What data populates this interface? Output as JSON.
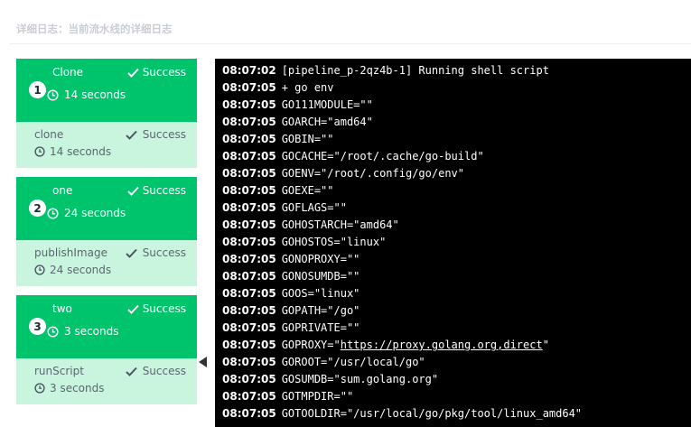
{
  "header": {
    "title": "详细日志：当前流水线的详细日志"
  },
  "stages": [
    {
      "num": "1",
      "name": "Clone",
      "status": "Success",
      "duration": "14 seconds",
      "step": {
        "name": "clone",
        "status": "Success",
        "duration": "14 seconds"
      }
    },
    {
      "num": "2",
      "name": "one",
      "status": "Success",
      "duration": "24 seconds",
      "step": {
        "name": "publishImage",
        "status": "Success",
        "duration": "24 seconds"
      }
    },
    {
      "num": "3",
      "name": "two",
      "status": "Success",
      "duration": "3 seconds",
      "step": {
        "name": "runScript",
        "status": "Success",
        "duration": "3 seconds"
      }
    }
  ],
  "log": {
    "lines": [
      {
        "time": "08:07:02",
        "text": "[pipeline_p-2qz4b-1] Running shell script"
      },
      {
        "time": "08:07:05",
        "text": "+ go env"
      },
      {
        "time": "08:07:05",
        "text": "GO111MODULE=\"\""
      },
      {
        "time": "08:07:05",
        "text": "GOARCH=\"amd64\""
      },
      {
        "time": "08:07:05",
        "text": "GOBIN=\"\""
      },
      {
        "time": "08:07:05",
        "text": "GOCACHE=\"/root/.cache/go-build\""
      },
      {
        "time": "08:07:05",
        "text": "GOENV=\"/root/.config/go/env\""
      },
      {
        "time": "08:07:05",
        "text": "GOEXE=\"\""
      },
      {
        "time": "08:07:05",
        "text": "GOFLAGS=\"\""
      },
      {
        "time": "08:07:05",
        "text": "GOHOSTARCH=\"amd64\""
      },
      {
        "time": "08:07:05",
        "text": "GOHOSTOS=\"linux\""
      },
      {
        "time": "08:07:05",
        "text": "GONOPROXY=\"\""
      },
      {
        "time": "08:07:05",
        "text": "GONOSUMDB=\"\""
      },
      {
        "time": "08:07:05",
        "text": "GOOS=\"linux\""
      },
      {
        "time": "08:07:05",
        "text": "GOPATH=\"/go\""
      },
      {
        "time": "08:07:05",
        "text": "GOPRIVATE=\"\""
      },
      {
        "time": "08:07:05",
        "text_pre": "GOPROXY=\"",
        "link": "https://proxy.golang.org,direct",
        "text_post": "\""
      },
      {
        "time": "08:07:05",
        "text": "GOROOT=\"/usr/local/go\""
      },
      {
        "time": "08:07:05",
        "text": "GOSUMDB=\"sum.golang.org\""
      },
      {
        "time": "08:07:05",
        "text": "GOTMPDIR=\"\""
      },
      {
        "time": "08:07:05",
        "text": "GOTOOLDIR=\"/usr/local/go/pkg/tool/linux_amd64\""
      }
    ]
  }
}
